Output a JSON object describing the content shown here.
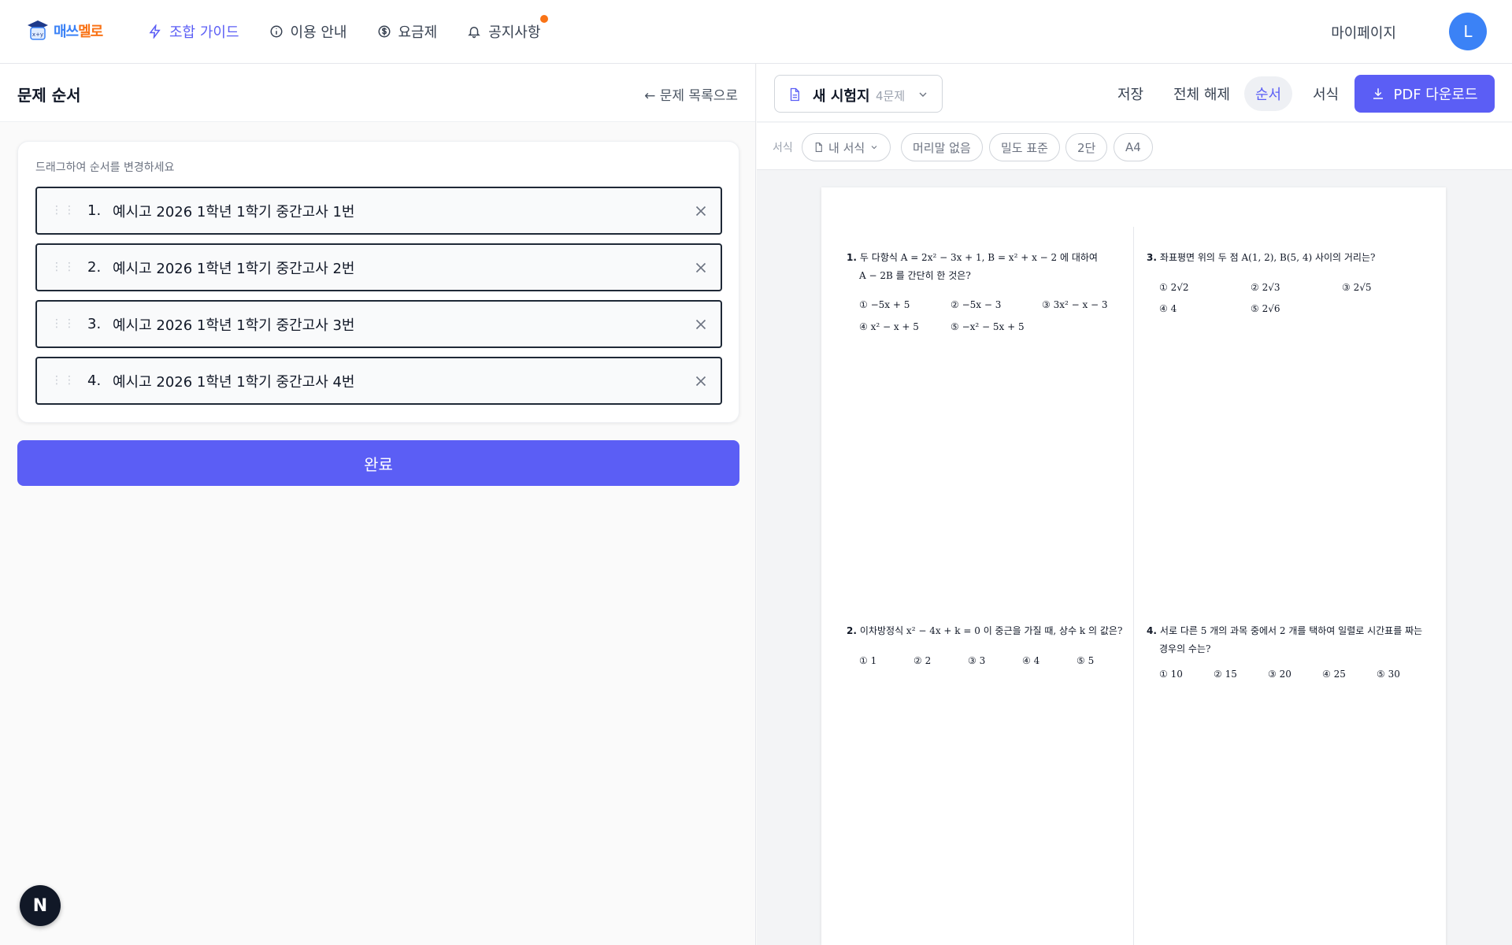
{
  "app": {
    "logo_part1": "매쓰",
    "logo_part2": "멜로"
  },
  "nav": {
    "items": [
      {
        "label": "조합 가이드"
      },
      {
        "label": "이용 안내"
      },
      {
        "label": "요금제"
      },
      {
        "label": "공지사항"
      }
    ],
    "mypage": "마이페이지",
    "avatar_initial": "L"
  },
  "left": {
    "title": "문제 순서",
    "back_link": "← 문제 목록으로",
    "hint": "드래그하여 순서를 변경하세요",
    "rows": [
      {
        "num": "1.",
        "text": "예시고 2026 1학년 1학기 중간고사 1번"
      },
      {
        "num": "2.",
        "text": "예시고 2026 1학년 1학기 중간고사 2번"
      },
      {
        "num": "3.",
        "text": "예시고 2026 1학년 1학기 중간고사 3번"
      },
      {
        "num": "4.",
        "text": "예시고 2026 1학년 1학기 중간고사 4번"
      }
    ],
    "done_button": "완료"
  },
  "toolbar": {
    "exam_title": "새 시험지",
    "exam_count": "4문제",
    "save": "저장",
    "clear_all": "전체 해제",
    "order": "순서",
    "format": "서식",
    "pdf_download": "PDF 다운로드"
  },
  "format_bar": {
    "label": "서식",
    "chips": [
      "내 서식",
      "머리말 없음",
      "밀도 표준",
      "2단",
      "A4"
    ]
  },
  "paper": {
    "q1": {
      "num": "1.",
      "line1": "두 다항식 A = 2x² − 3x + 1, B = x² + x − 2 에 대하여",
      "line2": "A − 2B 를 간단히 한 것은?",
      "choices": [
        "① −5x + 5",
        "② −5x − 3",
        "③ 3x² − x − 3",
        "④ x² − x + 5",
        "⑤ −x² − 5x + 5"
      ]
    },
    "q2": {
      "num": "2.",
      "line1": "이차방정식 x² − 4x + k = 0 이 중근을 가질 때, 상수 k 의 값은?",
      "choices": [
        "① 1",
        "② 2",
        "③ 3",
        "④ 4",
        "⑤ 5"
      ]
    },
    "q3": {
      "num": "3.",
      "line1": "좌표평면 위의 두 점 A(1, 2), B(5, 4) 사이의 거리는?",
      "choices": [
        "① 2√2",
        "② 2√3",
        "③ 2√5",
        "④ 4",
        "⑤ 2√6"
      ]
    },
    "q4": {
      "num": "4.",
      "line1": "서로 다른 5 개의 과목 중에서 2 개를 택하여 일렬로 시간표를 짜는",
      "line2": "경우의 수는?",
      "choices": [
        "① 10",
        "② 15",
        "③ 20",
        "④ 25",
        "⑤ 30"
      ]
    }
  },
  "colors": {
    "accent": "#5b5ef5",
    "notice_dot": "#f97316",
    "avatar": "#3b82f6"
  }
}
